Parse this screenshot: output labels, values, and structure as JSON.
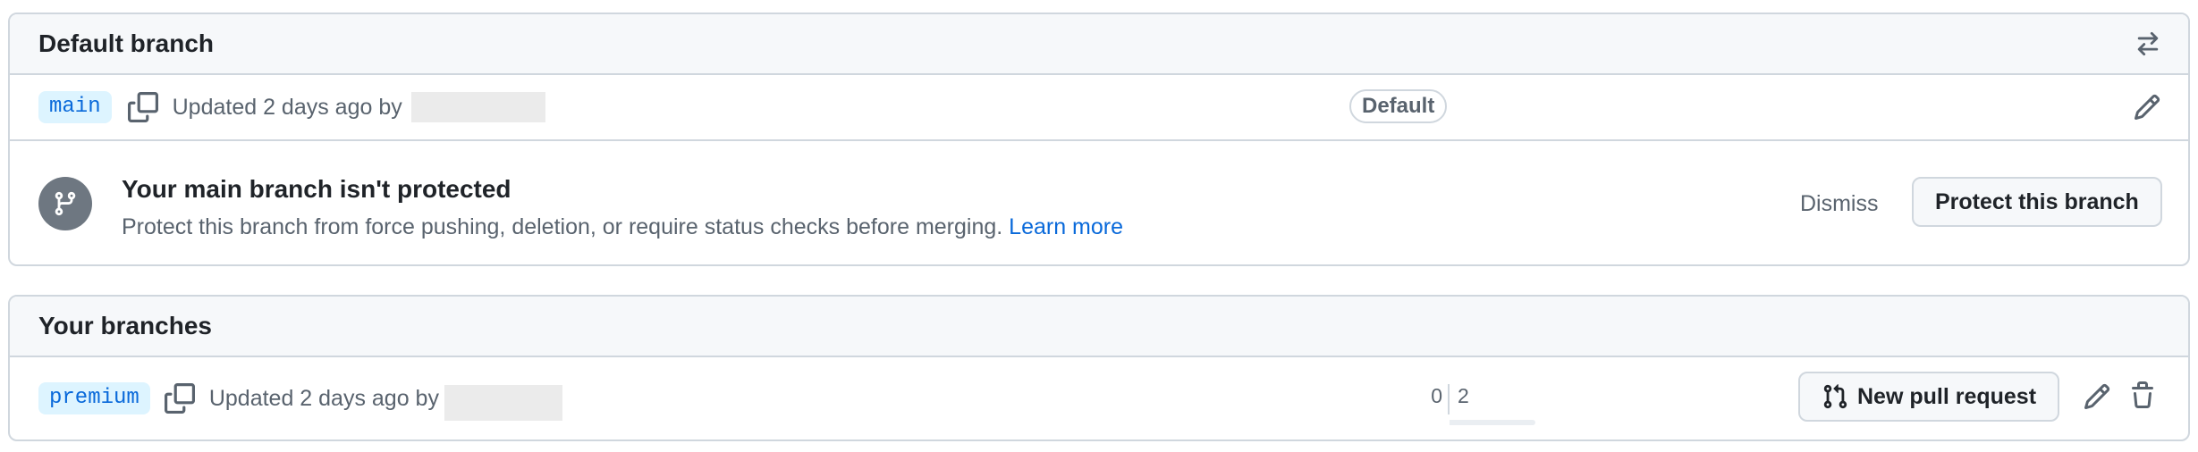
{
  "default_branch": {
    "title": "Default branch",
    "branch_name": "main",
    "updated_text": "Updated 2 days ago by",
    "badge": "Default",
    "alert": {
      "title": "Your main branch isn't protected",
      "description": "Protect this branch from force pushing, deletion, or require status checks before merging.",
      "link_text": "Learn more",
      "dismiss_label": "Dismiss",
      "protect_label": "Protect this branch"
    }
  },
  "your_branches": {
    "title": "Your branches",
    "branches": [
      {
        "name": "premium",
        "updated_text": "Updated 2 days ago by",
        "behind": "0",
        "ahead": "2",
        "new_pr_label": "New pull request"
      }
    ]
  },
  "colors": {
    "accent": "#0969da",
    "pill_bg": "#ddf4ff",
    "border": "#d0d7de",
    "header_bg": "#f6f8fa"
  },
  "icons": [
    "switch-arrows-icon",
    "copy-icon",
    "pencil-icon",
    "git-branch-icon",
    "git-pull-request-icon",
    "trash-icon"
  ]
}
